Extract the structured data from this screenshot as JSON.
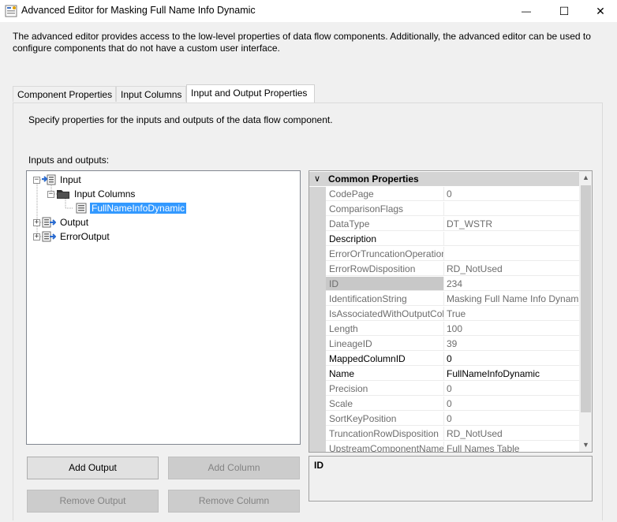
{
  "window": {
    "title": "Advanced Editor for Masking Full Name Info Dynamic",
    "icons": {
      "app": "advanced-editor-icon",
      "minimize": "minimize-icon",
      "maximize": "maximize-icon",
      "close": "close-icon"
    },
    "controls": {
      "minimize": "—",
      "maximize": "☐",
      "close": "✕"
    }
  },
  "description": "The advanced editor provides access to the low-level properties of data flow components. Additionally, the advanced editor can be used to configure components that do not have a custom user interface.",
  "tabs": [
    {
      "label": "Component Properties",
      "active": false
    },
    {
      "label": "Input Columns",
      "active": false
    },
    {
      "label": "Input and Output Properties",
      "active": true
    }
  ],
  "panel": {
    "description": "Specify properties for the inputs and outputs of the data flow component.",
    "io_label": "Inputs and outputs:"
  },
  "tree": {
    "nodes": [
      {
        "label": "Input",
        "expander": "−",
        "icon": "input-icon",
        "selected": false
      },
      {
        "label": "Input Columns",
        "expander": "−",
        "icon": "folder-icon",
        "selected": false
      },
      {
        "label": "FullNameInfoDynamic",
        "expander": "",
        "icon": "column-icon",
        "selected": true
      },
      {
        "label": "Output",
        "expander": "+",
        "icon": "output-icon",
        "selected": false
      },
      {
        "label": "ErrorOutput",
        "expander": "+",
        "icon": "output-icon",
        "selected": false
      }
    ]
  },
  "properties": {
    "category": "Common Properties",
    "rows": [
      {
        "name": "CodePage",
        "value": "0",
        "editable": false,
        "selected": false
      },
      {
        "name": "ComparisonFlags",
        "value": "",
        "editable": false,
        "selected": false
      },
      {
        "name": "DataType",
        "value": "DT_WSTR",
        "editable": false,
        "selected": false
      },
      {
        "name": "Description",
        "value": "",
        "editable": true,
        "selected": false
      },
      {
        "name": "ErrorOrTruncationOperation",
        "value": "",
        "editable": false,
        "selected": false
      },
      {
        "name": "ErrorRowDisposition",
        "value": "RD_NotUsed",
        "editable": false,
        "selected": false
      },
      {
        "name": "ID",
        "value": "234",
        "editable": false,
        "selected": true
      },
      {
        "name": "IdentificationString",
        "value": "Masking Full Name Info Dynamic",
        "editable": false,
        "selected": false
      },
      {
        "name": "IsAssociatedWithOutputColumn",
        "value": "True",
        "editable": false,
        "selected": false
      },
      {
        "name": "Length",
        "value": "100",
        "editable": false,
        "selected": false
      },
      {
        "name": "LineageID",
        "value": "39",
        "editable": false,
        "selected": false
      },
      {
        "name": "MappedColumnID",
        "value": "0",
        "editable": true,
        "selected": false
      },
      {
        "name": "Name",
        "value": "FullNameInfoDynamic",
        "editable": true,
        "selected": false
      },
      {
        "name": "Precision",
        "value": "0",
        "editable": false,
        "selected": false
      },
      {
        "name": "Scale",
        "value": "0",
        "editable": false,
        "selected": false
      },
      {
        "name": "SortKeyPosition",
        "value": "0",
        "editable": false,
        "selected": false
      },
      {
        "name": "TruncationRowDisposition",
        "value": "RD_NotUsed",
        "editable": false,
        "selected": false
      },
      {
        "name": "UpstreamComponentName",
        "value": "Full Names Table",
        "editable": false,
        "selected": false
      }
    ]
  },
  "help": {
    "title": "ID"
  },
  "buttons": {
    "add_output": {
      "label": "Add Output",
      "enabled": true
    },
    "add_column": {
      "label": "Add Column",
      "enabled": false
    },
    "remove_output": {
      "label": "Remove Output",
      "enabled": false
    },
    "remove_column": {
      "label": "Remove Column",
      "enabled": false
    }
  },
  "colors": {
    "selection": "#3399ff",
    "category_bg": "#d4d4d4"
  }
}
